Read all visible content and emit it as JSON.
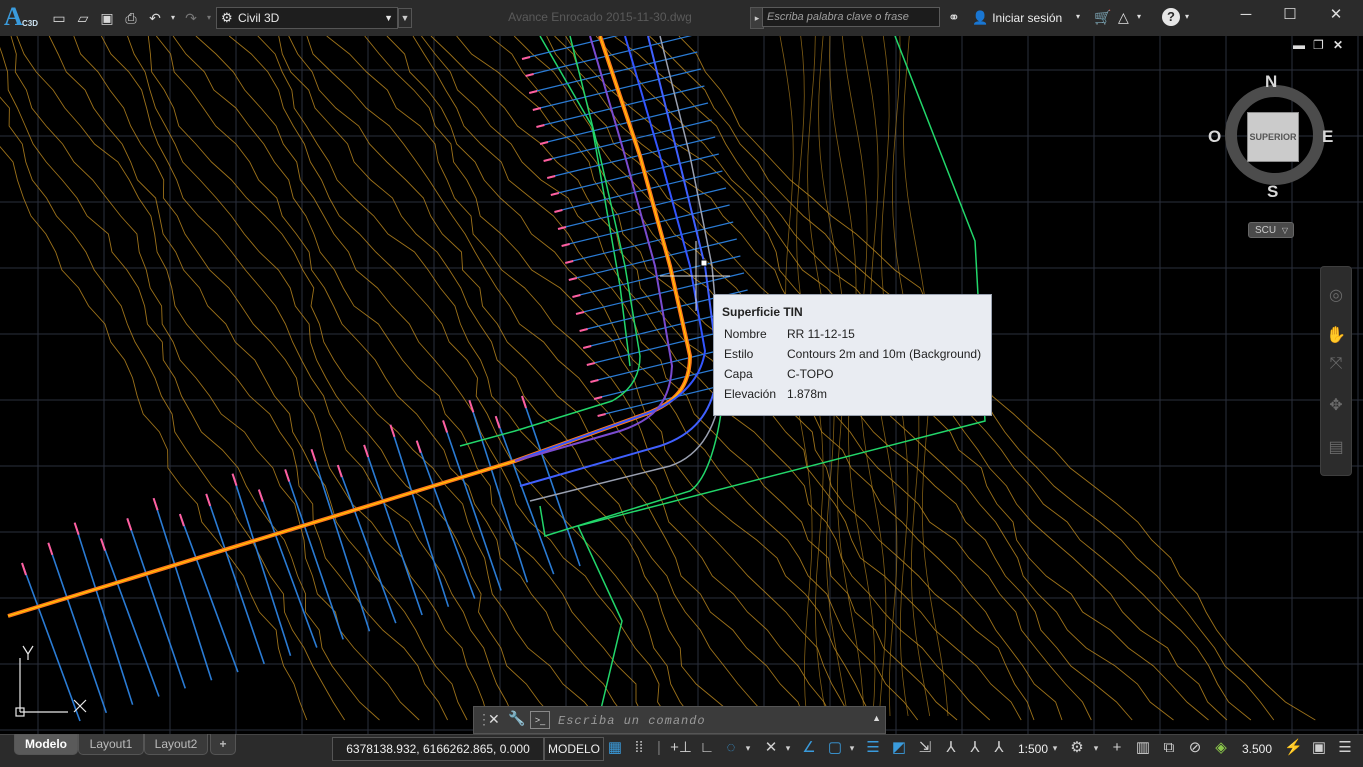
{
  "app": {
    "logo_big": "A",
    "logo_small": "C3D",
    "workspace": "Civil 3D",
    "document_title": "Avance Enrocado 2015-11-30.dwg",
    "search_placeholder": "Escriba palabra clave o frase",
    "login_label": "Iniciar sesión"
  },
  "viewcube": {
    "north": "N",
    "south": "S",
    "east": "E",
    "west": "O",
    "face": "SUPERIOR",
    "ucs_label": "SCU"
  },
  "tooltip": {
    "title": "Superficie TIN",
    "rows": [
      {
        "key": "Nombre",
        "value": "RR 11-12-15"
      },
      {
        "key": "Estilo",
        "value": "Contours 2m and 10m (Background)"
      },
      {
        "key": "Capa",
        "value": "C-TOPO"
      },
      {
        "key": "Elevación",
        "value": "1.878m"
      }
    ]
  },
  "command_line": {
    "placeholder": "Escriba un comando"
  },
  "layout_tabs": [
    "Modelo",
    "Layout1",
    "Layout2",
    "+"
  ],
  "status": {
    "coordinates": "6378138.932, 6166262.865, 0.000",
    "space": "MODELO",
    "scale": "1:500",
    "elevation": "3.500"
  },
  "colors": {
    "contour": "#b8861e",
    "alignment": "#ff7a1a",
    "sections": "#2a7bd4",
    "boundary": "#22d66a",
    "grid": "#2a2f3c",
    "accent": "#3a9bdc"
  },
  "icons": {
    "new": "new-icon",
    "open": "open-icon",
    "save": "save-icon",
    "print": "print-icon",
    "undo": "undo-icon",
    "redo": "redo-icon",
    "binoculars": "binoculars-icon",
    "user": "user-icon",
    "cart": "cart-icon",
    "help": "help-icon"
  }
}
